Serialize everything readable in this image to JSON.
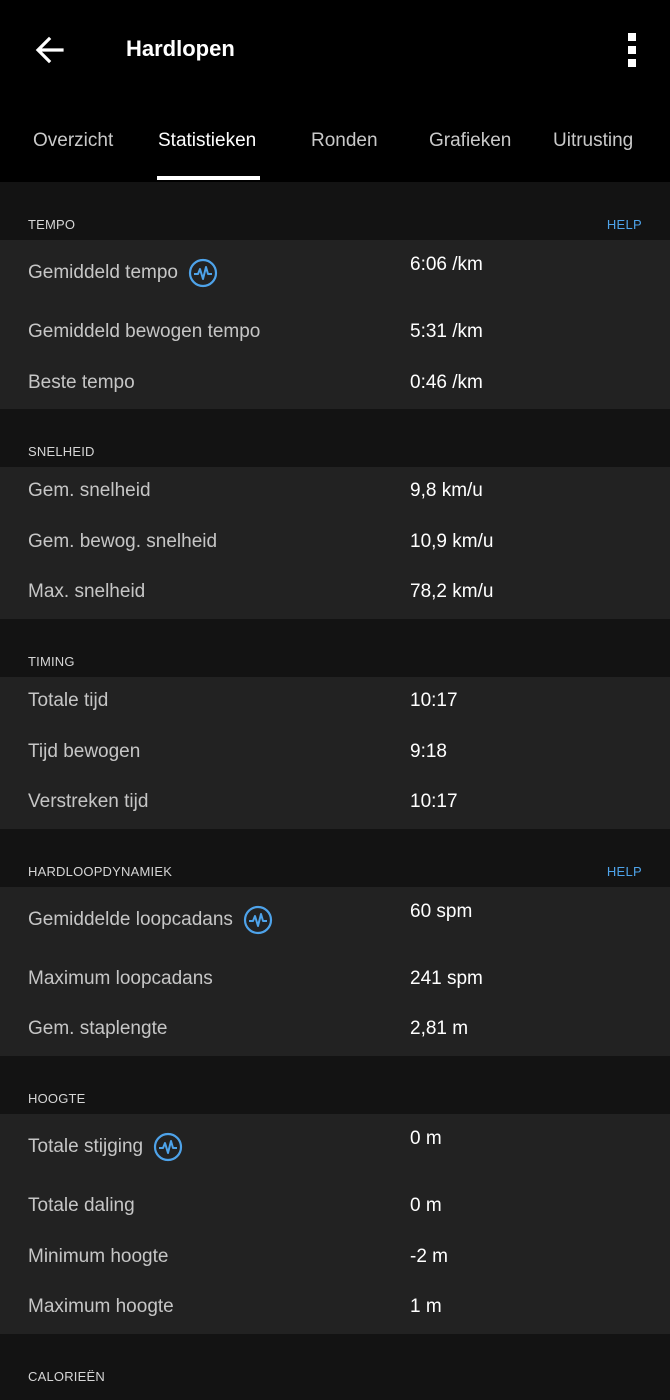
{
  "header": {
    "title": "Hardlopen"
  },
  "tabs": [
    {
      "label": "Overzicht"
    },
    {
      "label": "Statistieken"
    },
    {
      "label": "Ronden"
    },
    {
      "label": "Grafieken"
    },
    {
      "label": "Uitrusting"
    }
  ],
  "help_label": "HELP",
  "sections": {
    "tempo": {
      "title": "TEMPO",
      "rows": [
        {
          "label": "Gemiddeld tempo",
          "value": "6:06 /km"
        },
        {
          "label": "Gemiddeld bewogen tempo",
          "value": "5:31 /km"
        },
        {
          "label": "Beste tempo",
          "value": "0:46 /km"
        }
      ]
    },
    "snelheid": {
      "title": "SNELHEID",
      "rows": [
        {
          "label": "Gem. snelheid",
          "value": "9,8 km/u"
        },
        {
          "label": "Gem. bewog. snelheid",
          "value": "10,9 km/u"
        },
        {
          "label": "Max. snelheid",
          "value": "78,2 km/u"
        }
      ]
    },
    "timing": {
      "title": "TIMING",
      "rows": [
        {
          "label": "Totale tijd",
          "value": "10:17"
        },
        {
          "label": "Tijd bewogen",
          "value": "9:18"
        },
        {
          "label": "Verstreken tijd",
          "value": "10:17"
        }
      ]
    },
    "dynamiek": {
      "title": "HARDLOOPDYNAMIEK",
      "rows": [
        {
          "label": "Gemiddelde loopcadans",
          "value": "60 spm"
        },
        {
          "label": "Maximum loopcadans",
          "value": "241 spm"
        },
        {
          "label": "Gem. staplengte",
          "value": "2,81 m"
        }
      ]
    },
    "hoogte": {
      "title": "HOOGTE",
      "rows": [
        {
          "label": "Totale stijging",
          "value": "0 m"
        },
        {
          "label": "Totale daling",
          "value": "0 m"
        },
        {
          "label": "Minimum hoogte",
          "value": "-2 m"
        },
        {
          "label": "Maximum hoogte",
          "value": "1 m"
        }
      ]
    },
    "calorieen": {
      "title": "CALORIEËN"
    }
  },
  "colors": {
    "accent": "#4ea3ea",
    "background": "#131313",
    "card": "#222222",
    "header": "#000000"
  },
  "icons": {
    "back": "arrow-left-icon",
    "menu": "more-vertical-icon",
    "chart": "pulse-chart-icon"
  }
}
